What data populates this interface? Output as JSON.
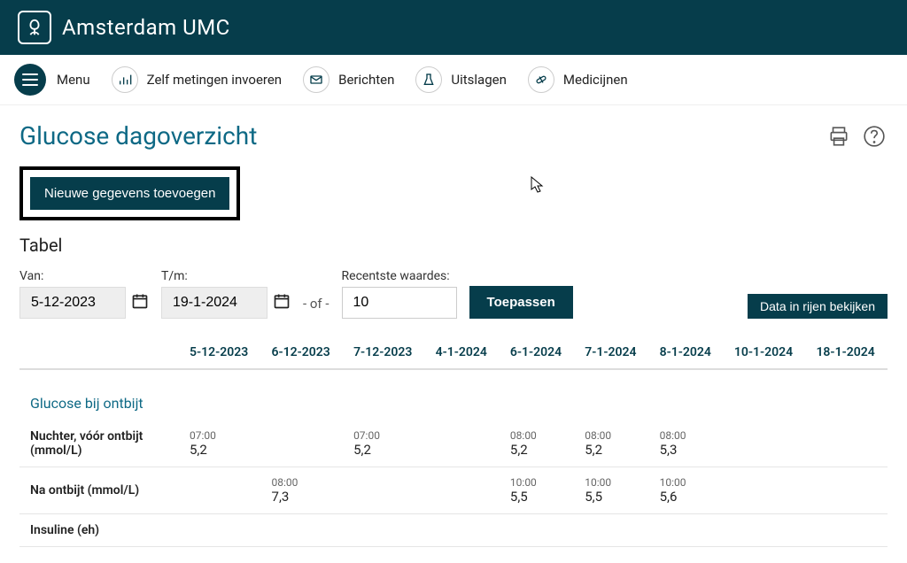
{
  "header": {
    "brand": "Amsterdam UMC"
  },
  "topnav": {
    "menu": "Menu",
    "items": [
      {
        "label": "Zelf metingen invoeren"
      },
      {
        "label": "Berichten"
      },
      {
        "label": "Uitslagen"
      },
      {
        "label": "Medicijnen"
      }
    ]
  },
  "page": {
    "title": "Glucose dagoverzicht",
    "add_button": "Nieuwe gegevens toevoegen",
    "table_title": "Tabel"
  },
  "filters": {
    "from_label": "Van:",
    "from_value": "5-12-2023",
    "to_label": "T/m:",
    "to_value": "19-1-2024",
    "or_sep": "- of -",
    "recent_label": "Recentste waardes:",
    "recent_value": "10",
    "apply": "Toepassen",
    "view_rows": "Data in rijen bekijken"
  },
  "table": {
    "dates": [
      "5-12-2023",
      "6-12-2023",
      "7-12-2023",
      "4-1-2024",
      "6-1-2024",
      "7-1-2024",
      "8-1-2024",
      "10-1-2024",
      "18-1-2024"
    ],
    "section1": "Glucose bij ontbijt",
    "rows": [
      {
        "label": "Nuchter, vóór ontbijt (mmol/L)",
        "cells": [
          {
            "time": "07:00",
            "val": "5,2"
          },
          null,
          {
            "time": "07:00",
            "val": "5,2"
          },
          null,
          {
            "time": "08:00",
            "val": "5,2"
          },
          {
            "time": "08:00",
            "val": "5,2"
          },
          {
            "time": "08:00",
            "val": "5,3"
          },
          null,
          null
        ]
      },
      {
        "label": "Na ontbijt (mmol/L)",
        "cells": [
          null,
          {
            "time": "08:00",
            "val": "7,3"
          },
          null,
          null,
          {
            "time": "10:00",
            "val": "5,5"
          },
          {
            "time": "10:00",
            "val": "5,5"
          },
          {
            "time": "10:00",
            "val": "5,6"
          },
          null,
          null
        ]
      },
      {
        "label": "Insuline (eh)",
        "cells": [
          null,
          null,
          null,
          null,
          null,
          null,
          null,
          null,
          null
        ]
      }
    ]
  }
}
